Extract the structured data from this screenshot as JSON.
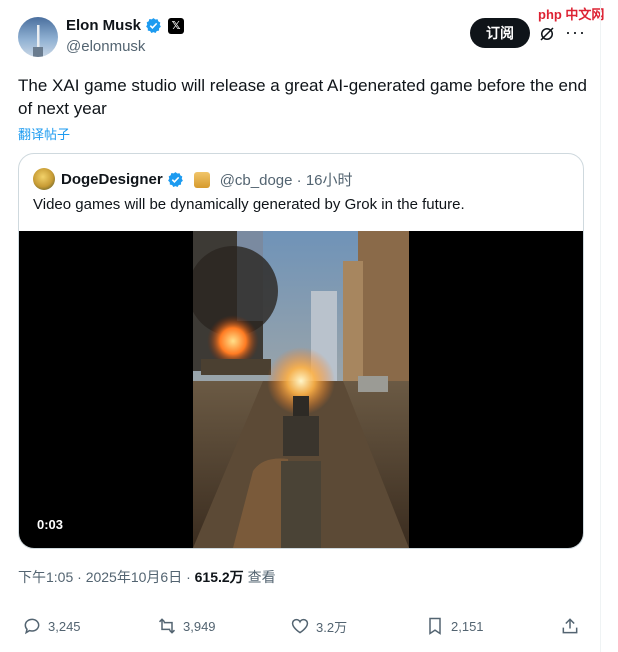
{
  "tweet": {
    "author_name": "Elon Musk",
    "author_handle": "@elonmusk",
    "subscribe_label": "订阅",
    "more_label": "···",
    "text": "The XAI game studio will release a great AI-generated game before the end of next year",
    "translate_label": "翻译帖子",
    "timestamp": "下午1:05 · 2025年10月6日 · ",
    "views_count": "615.2万",
    "views_label": " 查看"
  },
  "watermark": "php 中文网",
  "quote": {
    "author_name": "DogeDesigner",
    "handle_time": "@cb_doge · 16小时",
    "text": "Video games will be dynamically generated by Grok in the future.",
    "video_duration": "0:03"
  },
  "actions": {
    "replies": "3,245",
    "reposts": "3,949",
    "likes": "3.2万",
    "bookmarks": "2,151"
  },
  "icons": {
    "verified_color": "#1d9bf0",
    "accent": "#1d9bf0"
  }
}
